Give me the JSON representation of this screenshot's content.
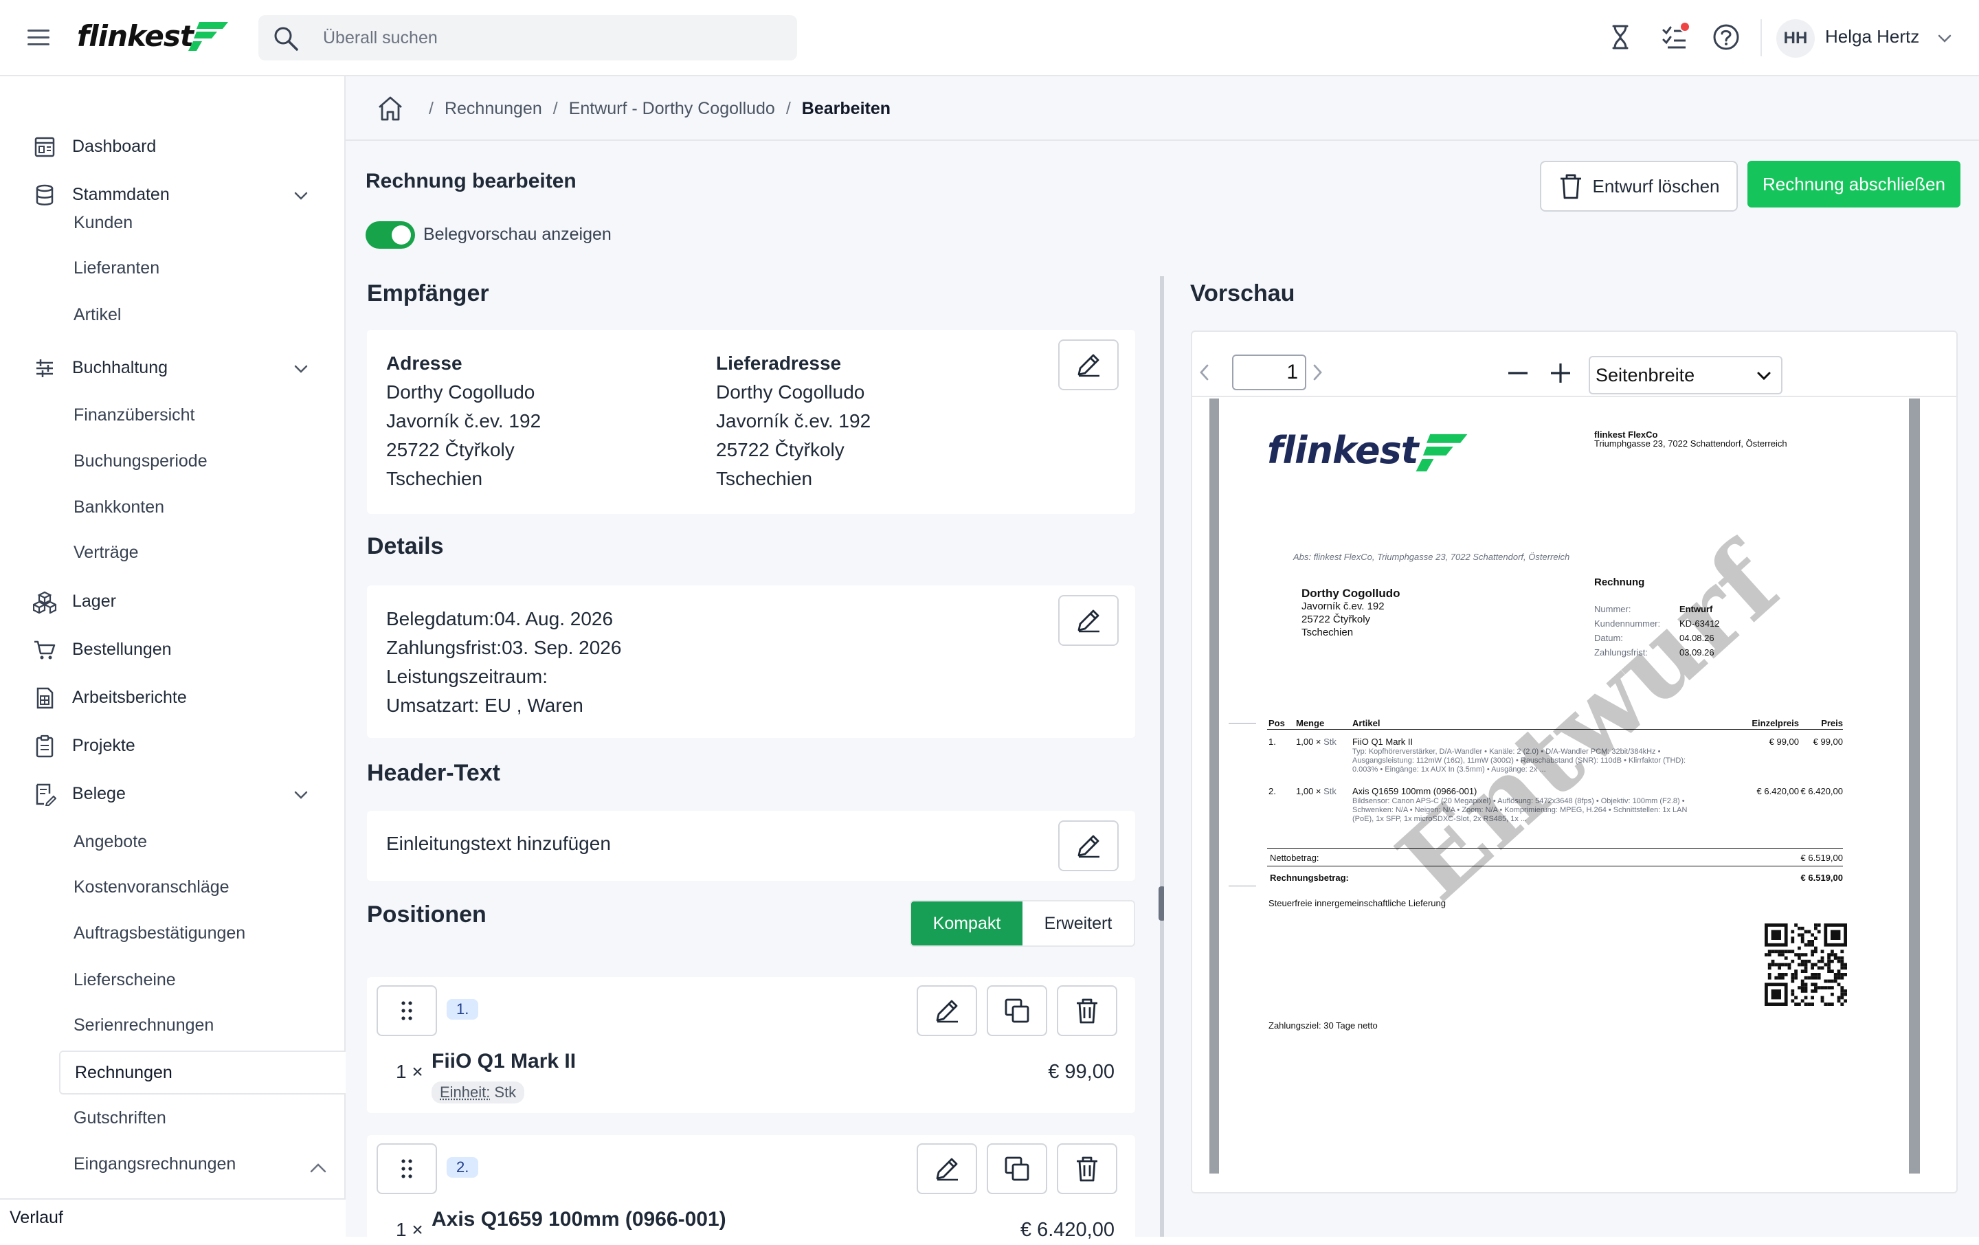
{
  "topbar": {
    "logo_text": "flinkest",
    "search_placeholder": "Überall suchen",
    "user_initials": "HH",
    "user_name": "Helga Hertz"
  },
  "sidebar": {
    "items": [
      {
        "label": "Dashboard",
        "icon": "dashboard-icon"
      },
      {
        "label": "Stammdaten",
        "icon": "database-icon"
      },
      {
        "label": "Kunden"
      },
      {
        "label": "Lieferanten"
      },
      {
        "label": "Artikel"
      },
      {
        "label": "Buchhaltung",
        "icon": "sliders-icon"
      },
      {
        "label": "Finanzübersicht"
      },
      {
        "label": "Buchungsperiode"
      },
      {
        "label": "Bankkonten"
      },
      {
        "label": "Verträge"
      },
      {
        "label": "Lager",
        "icon": "boxes-icon"
      },
      {
        "label": "Bestellungen",
        "icon": "cart-icon"
      },
      {
        "label": "Arbeitsberichte",
        "icon": "report-icon"
      },
      {
        "label": "Projekte",
        "icon": "clipboard-icon"
      },
      {
        "label": "Belege",
        "icon": "receipt-icon"
      },
      {
        "label": "Angebote"
      },
      {
        "label": "Kostenvoranschläge"
      },
      {
        "label": "Auftragsbestätigungen"
      },
      {
        "label": "Lieferscheine"
      },
      {
        "label": "Serienrechnungen"
      },
      {
        "label": "Rechnungen",
        "active": true
      },
      {
        "label": "Gutschriften"
      },
      {
        "label": "Eingangsrechnungen"
      }
    ],
    "footer": "Verlauf"
  },
  "breadcrumb": {
    "items": [
      "Rechnungen",
      "Entwurf - Dorthy Cogolludo",
      "Bearbeiten"
    ]
  },
  "page": {
    "title": "Rechnung bearbeiten",
    "toggle_label": "Belegvorschau anzeigen",
    "toggle_on": true,
    "delete_label": "Entwurf löschen",
    "finish_label": "Rechnung abschließen"
  },
  "recipient": {
    "title": "Empfänger",
    "address_heading": "Adresse",
    "address": [
      "Dorthy Cogolludo",
      "Javorník č.ev. 192",
      "25722 Čtyřkoly",
      "Tschechien"
    ],
    "delivery_heading": "Lieferadresse",
    "delivery": [
      "Dorthy Cogolludo",
      "Javorník č.ev. 192",
      "25722 Čtyřkoly",
      "Tschechien"
    ]
  },
  "details": {
    "title": "Details",
    "lines": [
      "Belegdatum:04. Aug. 2026",
      "Zahlungsfrist:03. Sep. 2026",
      "Leistungszeitraum:",
      "Umsatzart: EU , Waren"
    ]
  },
  "header_text": {
    "title": "Header-Text",
    "placeholder": "Einleitungstext hinzufügen"
  },
  "positions": {
    "title": "Positionen",
    "view_compact": "Kompakt",
    "view_extended": "Erweitert",
    "items": [
      {
        "num": "1.",
        "qty": "1 ×",
        "name": "FiiO Q1 Mark II",
        "unit_label": "Einheit:",
        "unit": "Stk",
        "price": "€ 99,00"
      },
      {
        "num": "2.",
        "qty": "1 ×",
        "name": "Axis Q1659 100mm (0966-001)",
        "price": "€ 6.420,00"
      }
    ]
  },
  "preview": {
    "title": "Vorschau",
    "page_number": "1",
    "zoom": "Seitenbreite",
    "doc": {
      "logo": "flinkest",
      "company": "flinkest FlexCo",
      "company_address": "Triumphgasse 23, 7022 Schattendorf, Österreich",
      "sender_line": "Abs: flinkest FlexCo, Triumphgasse 23, 7022 Schattendorf, Österreich",
      "recipient": [
        "Dorthy Cogolludo",
        "Javorník č.ev. 192",
        "25722 Čtyřkoly",
        "Tschechien"
      ],
      "doc_type": "Rechnung",
      "meta": [
        {
          "k": "Nummer:",
          "v": "Entwurf"
        },
        {
          "k": "Kundennummer:",
          "v": "KD-63412"
        },
        {
          "k": "Datum:",
          "v": "04.08.26"
        },
        {
          "k": "Zahlungsfrist:",
          "v": "03.09.26"
        }
      ],
      "table_headers": [
        "Pos",
        "Menge",
        "Artikel",
        "Einzelpreis",
        "Preis"
      ],
      "rows": [
        {
          "pos": "1.",
          "qty": "1,00 ×",
          "unit": "Stk",
          "name": "FiiO Q1 Mark II",
          "desc": [
            "Typ: Kopfhörerverstärker, D/A-Wandler • Kanäle: 2 (2.0) • D/A-Wandler PCM: 32bit/384kHz •",
            "Ausgangsleistung: 112mW (16Ω), 11mW (300Ω) • Rauschabstand (SNR): 110dB • Klirrfaktor (THD):",
            "0.003% • Eingänge: 1x AUX In (3.5mm) • Ausgänge: 2x ..."
          ],
          "unit_price": "€ 99,00",
          "price": "€ 99,00"
        },
        {
          "pos": "2.",
          "qty": "1,00 ×",
          "unit": "Stk",
          "name": "Axis Q1659 100mm (0966-001)",
          "desc": [
            "Bildsensor: Canon APS-C (20 Megapixel) • Auflösung: 5472x3648 (8fps) • Objektiv: 100mm (F2.8) •",
            "Schwenken: N/A • Neigen: N/A • Zoom: N/A • Komprimierung: MPEG, H.264 • Schnittstellen: 1x LAN",
            "(PoE), 1x SFP, 1x microSDXC-Slot, 2x RS485, 1x ..."
          ],
          "unit_price": "€ 6.420,00",
          "price": "€ 6.420,00"
        }
      ],
      "net_label": "Nettobetrag:",
      "net_value": "€ 6.519,00",
      "total_label": "Rechnungsbetrag:",
      "total_value": "€ 6.519,00",
      "tax_note": "Steuerfreie innergemeinschaftliche Lieferung",
      "payment_terms": "Zahlungsziel: 30 Tage netto",
      "watermark": "Entwurf"
    }
  },
  "colors": {
    "brand_green": "#16c45c",
    "toggle_green": "#16a34a",
    "active_segment": "#17a055"
  }
}
